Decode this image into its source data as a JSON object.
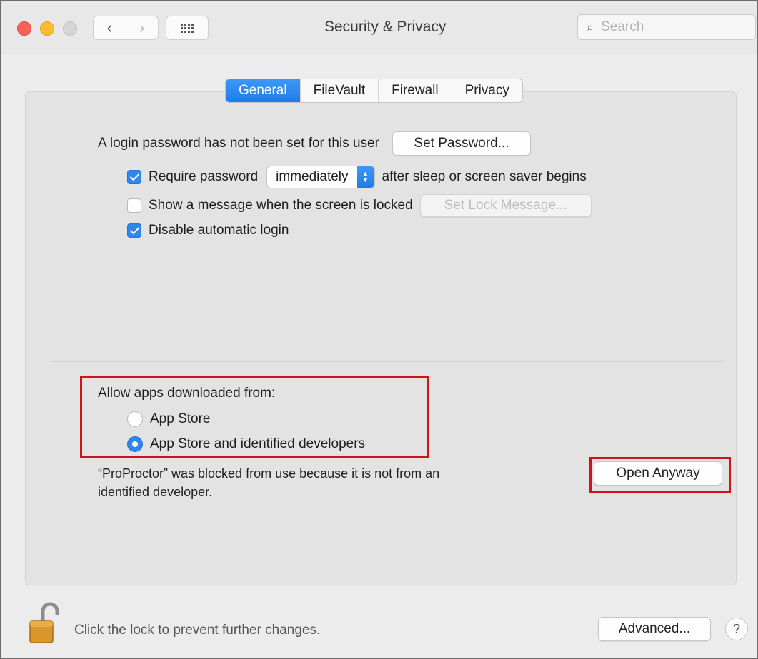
{
  "window": {
    "title": "Security & Privacy",
    "search_placeholder": "Search"
  },
  "tabs": [
    {
      "label": "General",
      "active": true
    },
    {
      "label": "FileVault",
      "active": false
    },
    {
      "label": "Firewall",
      "active": false
    },
    {
      "label": "Privacy",
      "active": false
    }
  ],
  "general": {
    "login_password_text": "A login password has not been set for this user",
    "set_password_button": "Set Password...",
    "require_password": {
      "checked": true,
      "label": "Require password",
      "dropdown_value": "immediately",
      "suffix": "after sleep or screen saver begins"
    },
    "show_message": {
      "checked": false,
      "label": "Show a message when the screen is locked",
      "button": "Set Lock Message..."
    },
    "disable_auto_login": {
      "checked": true,
      "label": "Disable automatic login"
    }
  },
  "allow_apps": {
    "heading": "Allow apps downloaded from:",
    "options": [
      {
        "label": "App Store",
        "selected": false
      },
      {
        "label": "App Store and identified developers",
        "selected": true
      }
    ]
  },
  "blocked": {
    "line1": "“ProProctor” was blocked from use because it is not from an",
    "line2": "identified developer.",
    "open_anyway_button": "Open Anyway"
  },
  "footer": {
    "lock_text": "Click the lock to prevent further changes.",
    "advanced_button": "Advanced...",
    "help_button": "?"
  },
  "colors": {
    "accent": "#2f86ef",
    "highlight": "#d0121b"
  }
}
